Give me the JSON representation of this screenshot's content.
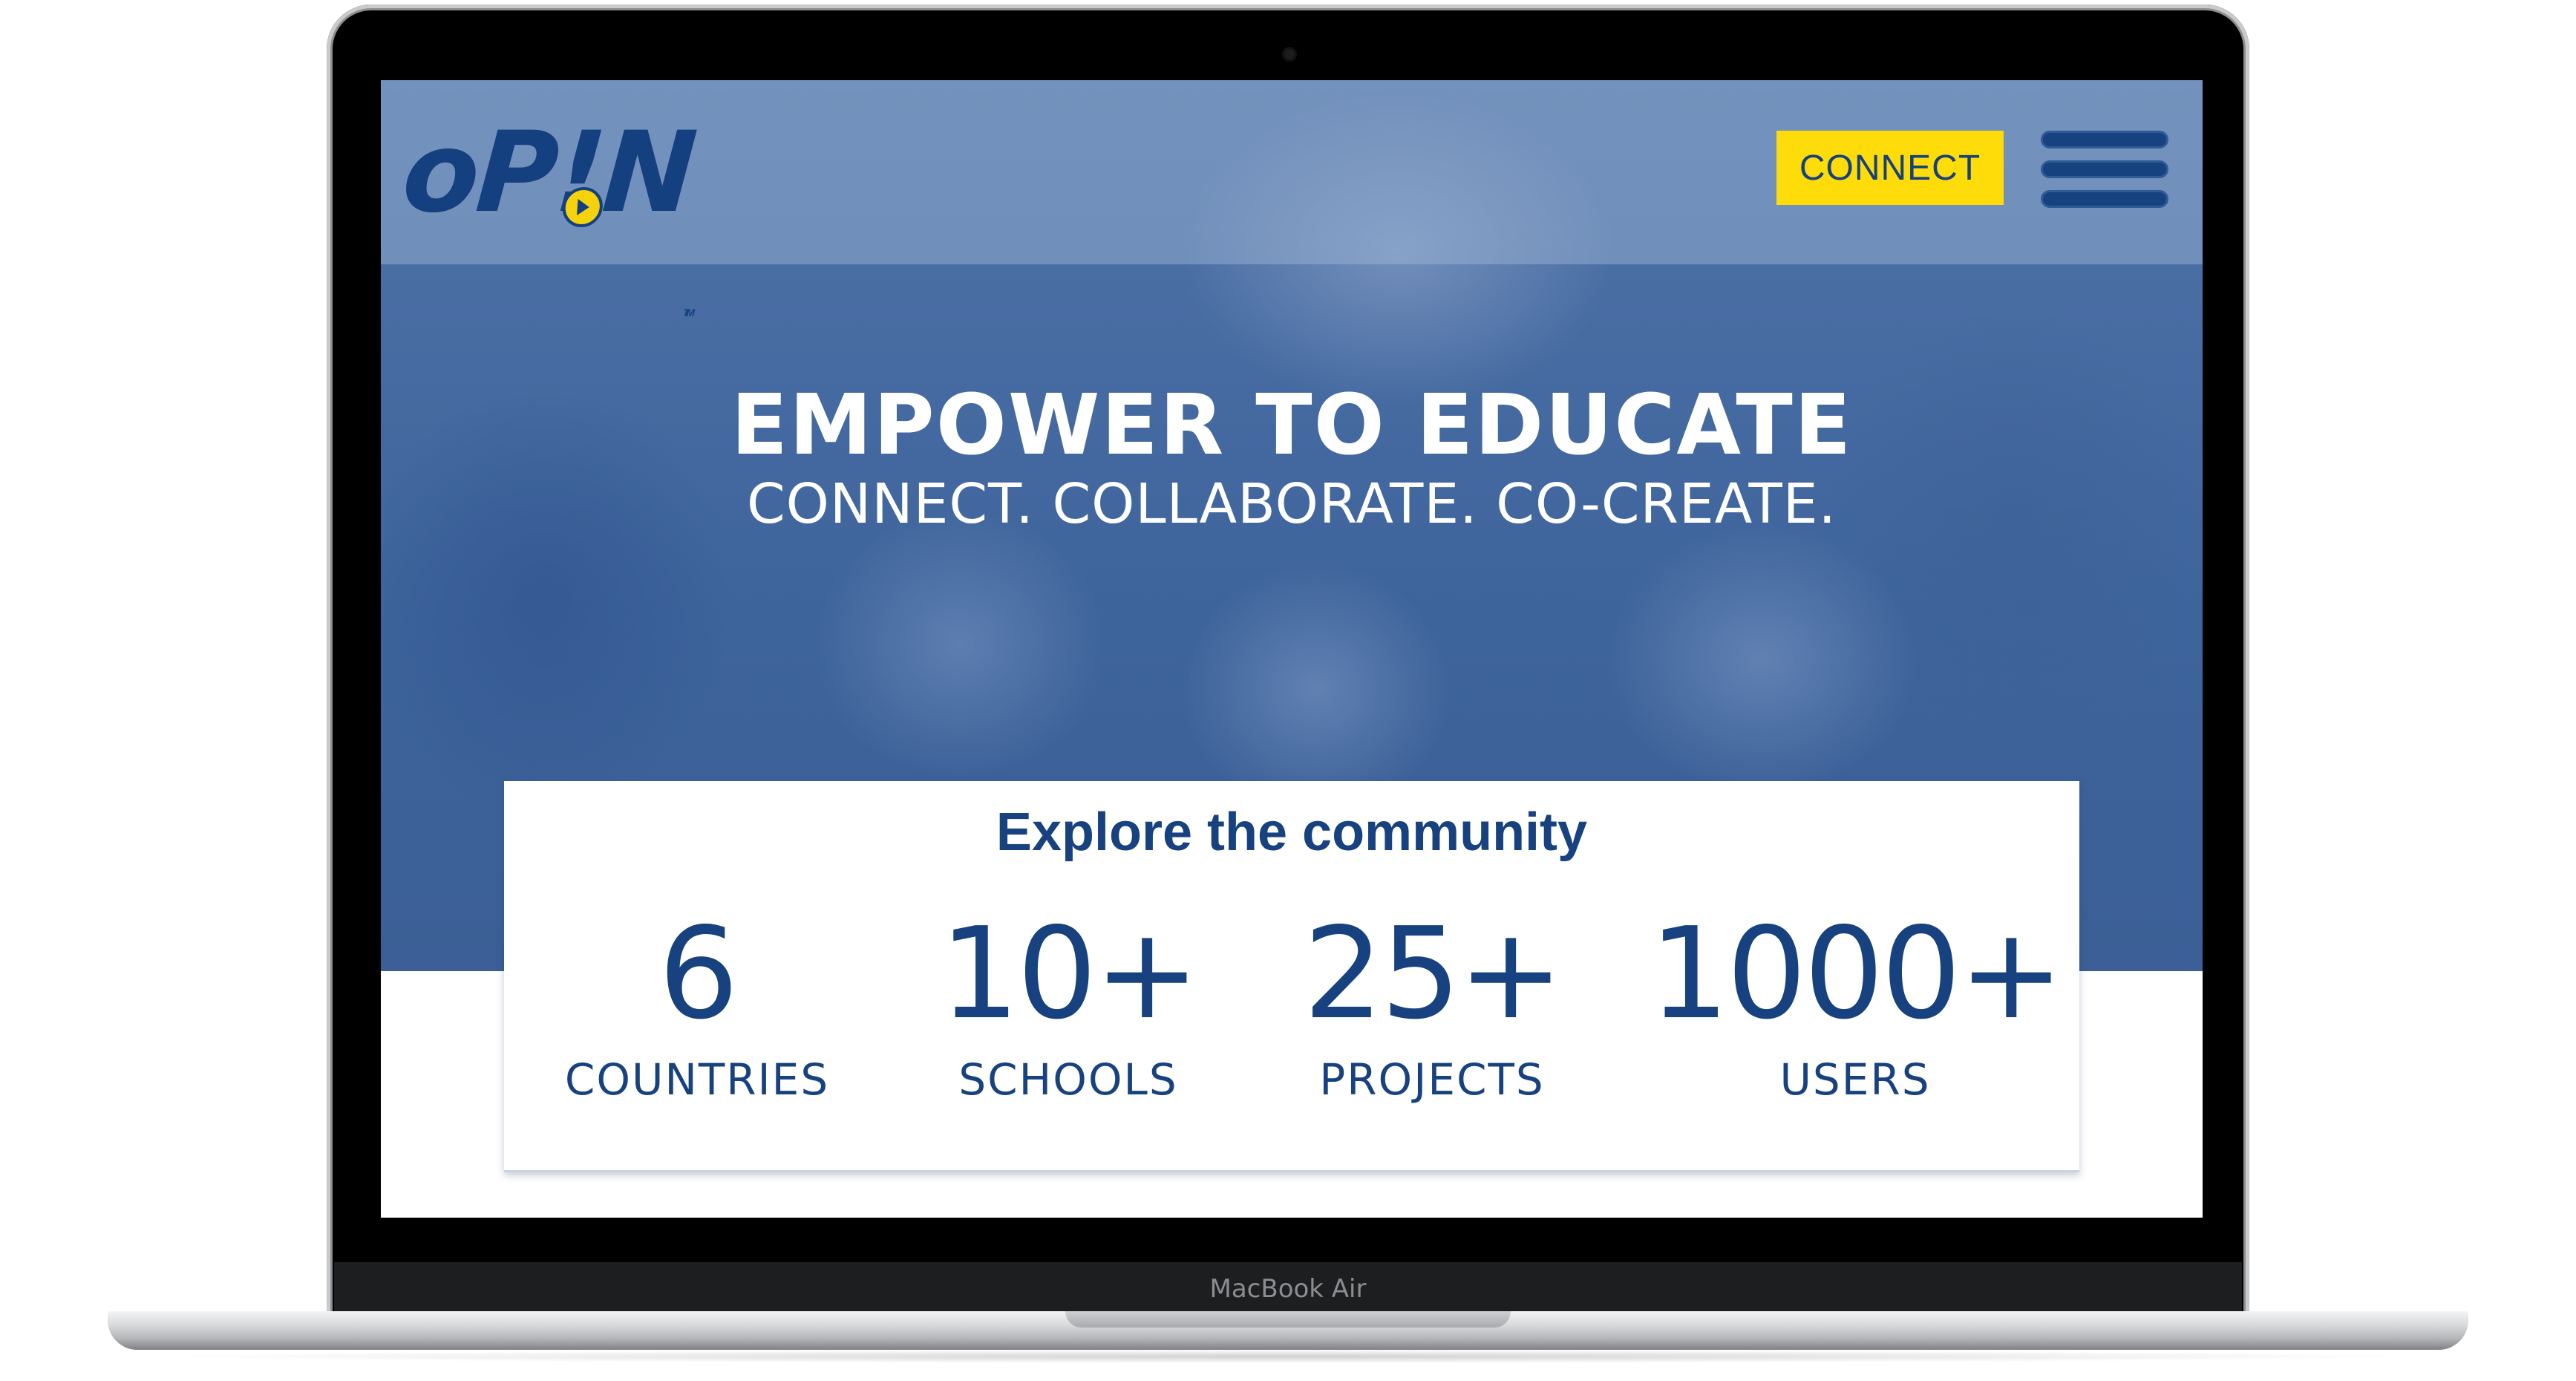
{
  "header": {
    "logo_text": "oP!N",
    "logo_tm": "TM",
    "connect_label": "CONNECT"
  },
  "hero": {
    "title": "EMPOWER TO EDUCATE",
    "subtitle": "CONNECT. COLLABORATE. CO-CREATE."
  },
  "community": {
    "title": "Explore the community",
    "stats": [
      {
        "value": "6",
        "label": "COUNTRIES"
      },
      {
        "value": "10+",
        "label": "SCHOOLS"
      },
      {
        "value": "25+",
        "label": "PROJECTS"
      },
      {
        "value": "1000+",
        "label": "USERS"
      }
    ]
  },
  "device": {
    "label": "MacBook Air"
  },
  "colors": {
    "brand_blue": "#17427f",
    "accent_yellow": "#fddc0a"
  }
}
